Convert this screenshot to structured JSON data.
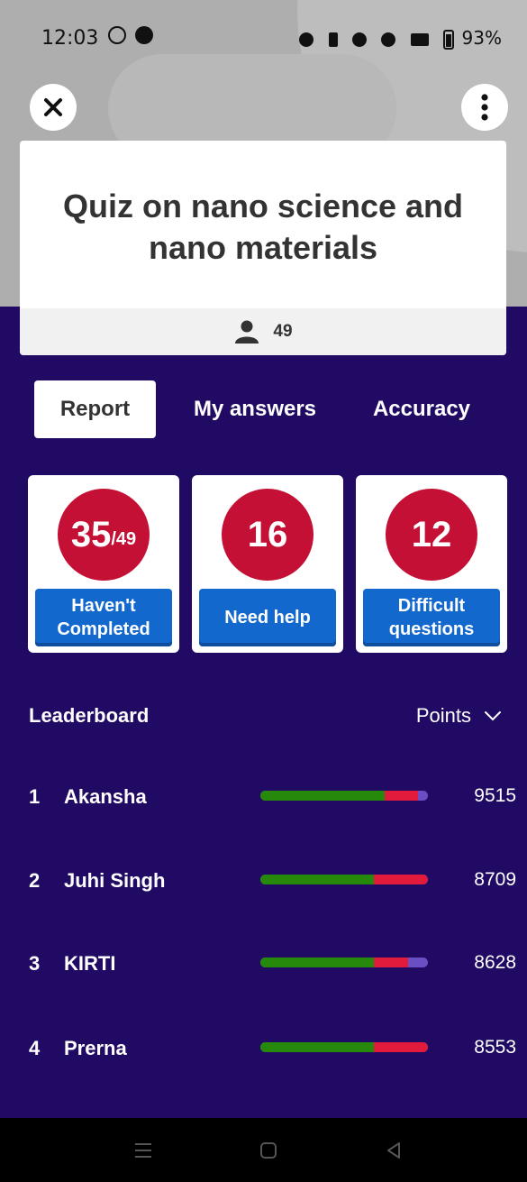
{
  "status_bar": {
    "time": "12:03",
    "battery": "93%"
  },
  "header": {
    "close_icon": "close-icon",
    "more_icon": "more-vertical-icon"
  },
  "quiz": {
    "title": "Quiz on nano science and nano materials",
    "player_count": "49"
  },
  "tabs": [
    {
      "label": "Report",
      "active": true
    },
    {
      "label": "My answers",
      "active": false
    },
    {
      "label": "Accuracy",
      "active": false
    }
  ],
  "summary_cards": [
    {
      "value": "35",
      "suffix": "/49",
      "label": "Haven't\nCompleted"
    },
    {
      "value": "16",
      "suffix": "",
      "label": "Need help"
    },
    {
      "value": "12",
      "suffix": "",
      "label": "Difficult\nquestions"
    }
  ],
  "leaderboard": {
    "title": "Leaderboard",
    "sort_label": "Points",
    "rows": [
      {
        "rank": "1",
        "name": "Akansha",
        "score": "9515",
        "correct": 0.74,
        "incorrect": 0.2
      },
      {
        "rank": "2",
        "name": "Juhi Singh",
        "score": "8709",
        "correct": 0.68,
        "incorrect": 0.32
      },
      {
        "rank": "3",
        "name": "KIRTI",
        "score": "8628",
        "correct": 0.68,
        "incorrect": 0.2
      },
      {
        "rank": "4",
        "name": "Prerna",
        "score": "8553",
        "correct": 0.68,
        "incorrect": 0.32
      }
    ]
  },
  "colors": {
    "background": "#200a63",
    "correct": "#26890c",
    "incorrect": "#e21b3c",
    "unanswered": "#6a4fc4",
    "badge": "#c41035",
    "button": "#1368ce"
  }
}
